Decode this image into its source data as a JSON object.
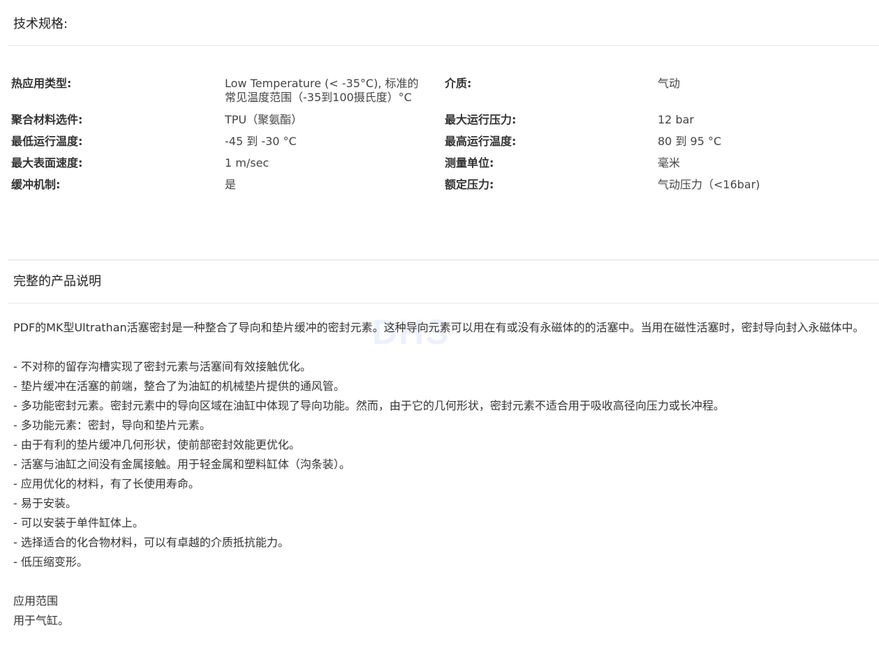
{
  "spec_section": {
    "title": "技术规格:",
    "rows": [
      {
        "label1": "热应用类型:",
        "value1": "Low Temperature (< -35°C), 标准的常见温度范围（-35到100摄氏度）°C",
        "label2": "介质:",
        "value2": "气动"
      },
      {
        "label1": "聚合材料选件:",
        "value1": "TPU（聚氨酯）",
        "label2": "最大运行压力:",
        "value2": "12 bar"
      },
      {
        "label1": "最低运行温度:",
        "value1": "-45 到 -30 °C",
        "label2": "最高运行温度:",
        "value2": "80 到 95 °C"
      },
      {
        "label1": "最大表面速度:",
        "value1": "1 m/sec",
        "label2": "测量单位:",
        "value2": "毫米"
      },
      {
        "label1": "缓冲机制:",
        "value1": "是",
        "label2": "额定压力:",
        "value2": "气动压力（<16bar)"
      }
    ]
  },
  "description_section": {
    "title": "完整的产品说明",
    "intro": "PDF的MK型Ultrathan活塞密封是一种整合了导向和垫片缓冲的密封元素。这种导向元素可以用在有或没有永磁体的的活塞中。当用在磁性活塞时，密封导向封入永磁体中。",
    "features": [
      " - 不对称的留存沟槽实现了密封元素与活塞间有效接触优化。",
      " - 垫片缓冲在活塞的前端，整合了为油缸的机械垫片提供的通风管。",
      " - 多功能密封元素。密封元素中的导向区域在油缸中体现了导向功能。然而，由于它的几何形状，密封元素不适合用于吸收高径向压力或长冲程。",
      " - 多功能元素：密封，导向和垫片元素。",
      " - 由于有利的垫片缓冲几何形状，使前部密封效能更优化。",
      " - 活塞与油缸之间没有金属接触。用于轻金属和塑料缸体（沟条装）。",
      " - 应用优化的材料，有了长使用寿命。",
      " - 易于安装。",
      " - 可以安装于单件缸体上。",
      " - 选择适合的化合物材料，可以有卓越的介质抵抗能力。",
      " - 低压缩变形。"
    ],
    "application_title": "应用范围",
    "application_text": "用于气缸。"
  },
  "watermark": {
    "text": "DHS",
    "mark": "™"
  }
}
